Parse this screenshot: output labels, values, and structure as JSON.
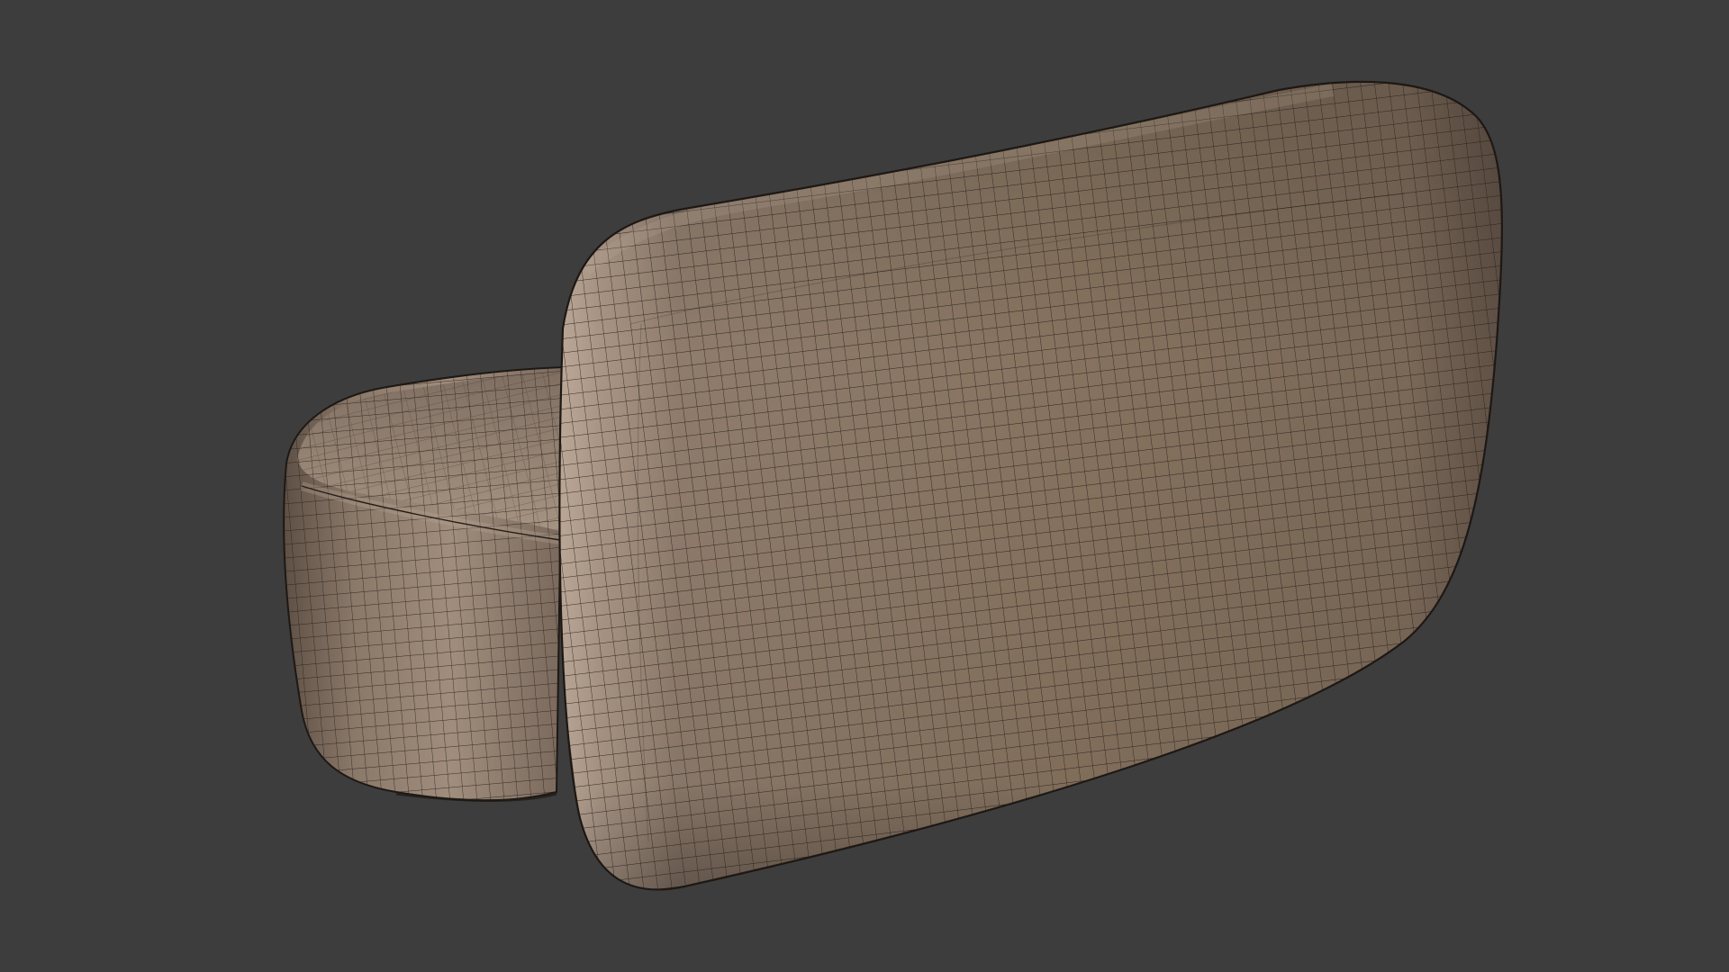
{
  "viewport": {
    "background_color": "#3d3d3d",
    "mode": "wireframe-on-shaded"
  },
  "model": {
    "surface_color": "#8a7766",
    "highlight_color": "#b8a595",
    "shadow_color": "#4e4239",
    "wire_color": "#231c17",
    "objects": [
      "seat-cushion",
      "backrest-cushion"
    ]
  }
}
